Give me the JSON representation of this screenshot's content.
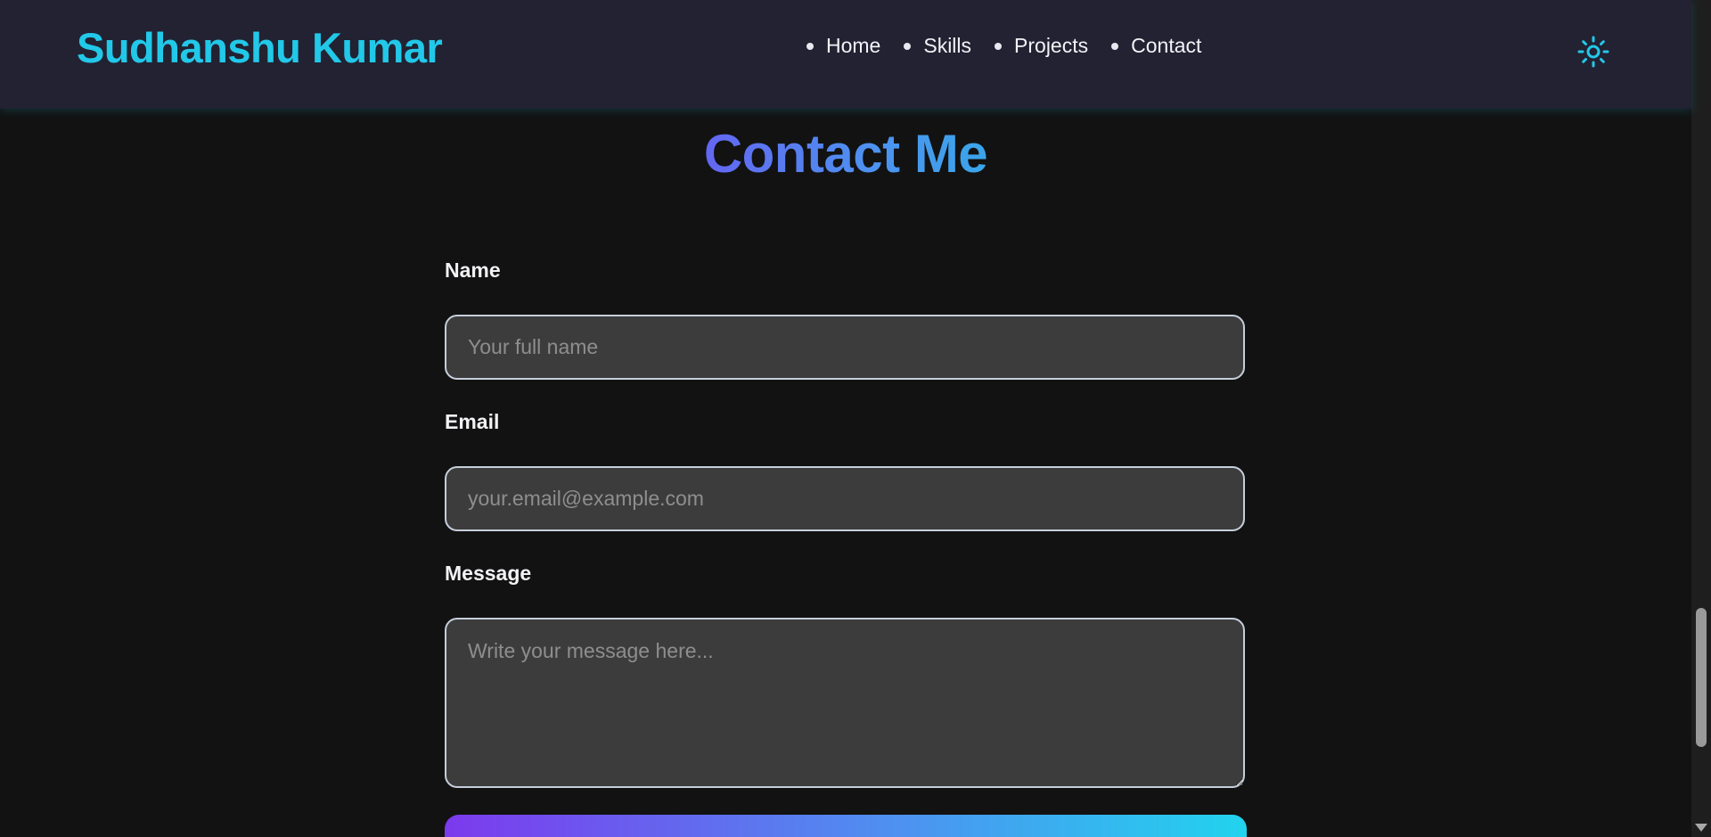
{
  "header": {
    "brand": "Sudhanshu Kumar",
    "nav_items": [
      {
        "label": "Home"
      },
      {
        "label": "Skills"
      },
      {
        "label": "Projects"
      },
      {
        "label": "Contact"
      }
    ],
    "theme_toggle_icon": "sun-icon"
  },
  "contact": {
    "title": "Contact Me",
    "fields": {
      "name": {
        "label": "Name",
        "placeholder": "Your full name",
        "value": ""
      },
      "email": {
        "label": "Email",
        "placeholder": "your.email@example.com",
        "value": ""
      },
      "message": {
        "label": "Message",
        "placeholder": "Write your message here...",
        "value": ""
      }
    }
  },
  "colors": {
    "accent": "#22c8e8",
    "title_gradient_start": "#6366f1",
    "title_gradient_end": "#3aa6ea",
    "button_gradient_start": "#7c3aed",
    "button_gradient_end": "#22d3ee",
    "background": "#121212",
    "header_background": "#222232"
  }
}
